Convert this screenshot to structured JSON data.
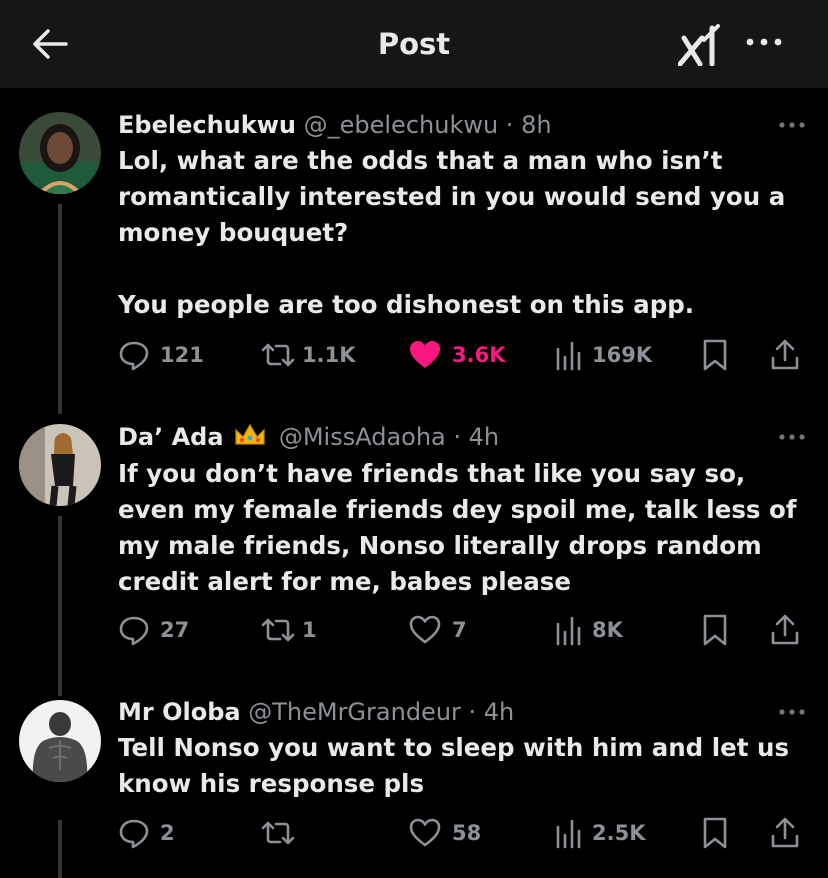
{
  "header": {
    "title": "Post"
  },
  "posts": [
    {
      "name": "Ebelechukwu",
      "handle": "@_ebelechukwu · 8h",
      "text": "Lol, what are the odds that a man who isn’t romantically interested in you would send you a money bouquet?\n\nYou people are too dishonest on this app.",
      "replies": "121",
      "reposts": "1.1K",
      "likes": "3.6K",
      "liked": true,
      "views": "169K"
    },
    {
      "name": "Da’ Ada",
      "handle": "@MissAdaoha · 4h",
      "text": "If you don’t have friends that like you say so, even my female friends dey spoil me, talk less of my male friends, Nonso literally drops random credit alert for me, babes please",
      "replies": "27",
      "reposts": "1",
      "likes": "7",
      "liked": false,
      "views": "8K"
    },
    {
      "name": "Mr Oloba",
      "handle": "@TheMrGrandeur · 4h",
      "text": "Tell Nonso you want to sleep with him and let us know his response pls",
      "replies": "2",
      "reposts": "",
      "likes": "58",
      "liked": false,
      "views": "2.5K"
    }
  ],
  "colors": {
    "like": "#f91880",
    "muted": "#8b9196",
    "text": "#e7e9ea"
  }
}
